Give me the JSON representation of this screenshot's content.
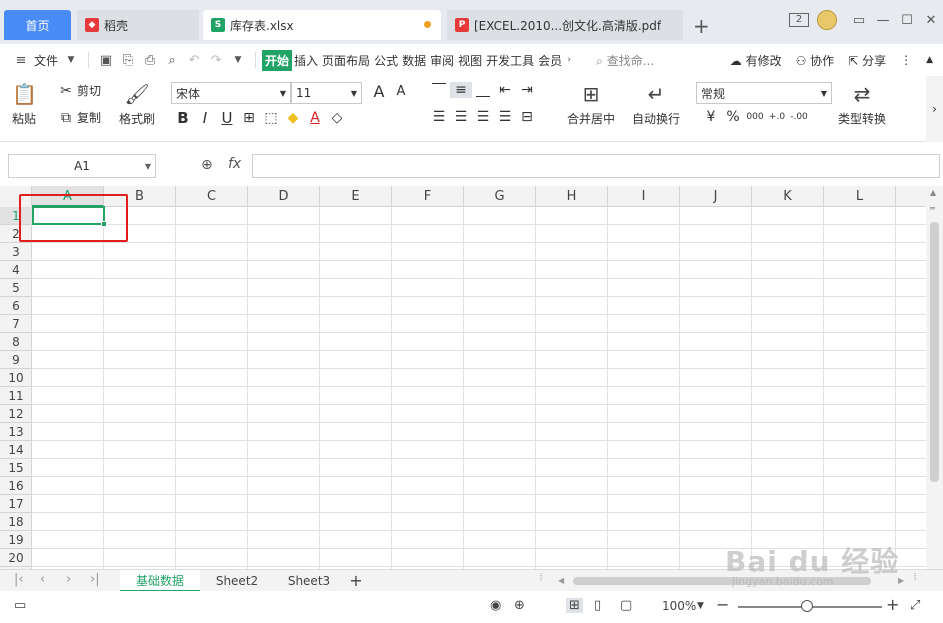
{
  "tabs": {
    "home": "首页",
    "daoke": "稻壳",
    "active": "库存表.xlsx",
    "pdf": "[EXCEL.2010...创文化.高清版.pdf",
    "newtab": "+",
    "account_badge": "2"
  },
  "menu": {
    "file": "文件",
    "items": [
      "开始",
      "插入",
      "页面布局",
      "公式",
      "数据",
      "审阅",
      "视图",
      "开发工具",
      "会员"
    ],
    "search": "查找命...",
    "changes": "有修改",
    "collab": "协作",
    "share": "分享"
  },
  "ribbon": {
    "paste": "粘贴",
    "cut": "剪切",
    "copy": "复制",
    "format_painter": "格式刷",
    "font_name": "宋体",
    "font_size": "11",
    "merge_center": "合并居中",
    "wrap_text": "自动换行",
    "number_format": "常规",
    "type_convert": "类型转换",
    "bold": "B",
    "italic": "I",
    "underline": "U",
    "percent": "%",
    "currency": "¥",
    "thousands": "000",
    "inc_decimal": "+.0",
    "dec_decimal": "-.00",
    "grow_font": "A",
    "shrink_font": "A",
    "font_color": "A",
    "fill_color": "◆"
  },
  "formula": {
    "name_box": "A1",
    "fx": "fx",
    "value": ""
  },
  "grid": {
    "columns": [
      "A",
      "B",
      "C",
      "D",
      "E",
      "F",
      "G",
      "H",
      "I",
      "J",
      "K",
      "L"
    ],
    "rows": [
      "1",
      "2",
      "3",
      "4",
      "5",
      "6",
      "7",
      "8",
      "9",
      "10",
      "11",
      "12",
      "13",
      "14",
      "15",
      "16",
      "17",
      "18",
      "19",
      "20"
    ],
    "selected_column": "A",
    "selected_row": "1"
  },
  "sheets": {
    "tabs": [
      "基础数据",
      "Sheet2",
      "Sheet3"
    ],
    "active": "基础数据",
    "add": "+"
  },
  "status": {
    "zoom": "100%",
    "zoom_minus": "−",
    "zoom_plus": "+"
  },
  "watermark": {
    "brand": "Bai du 经验",
    "url": "jingyan.baidu.com"
  },
  "colors": {
    "accent": "#21a366",
    "home_tab": "#4a8cf7",
    "highlight_box": "#e01e1e"
  }
}
